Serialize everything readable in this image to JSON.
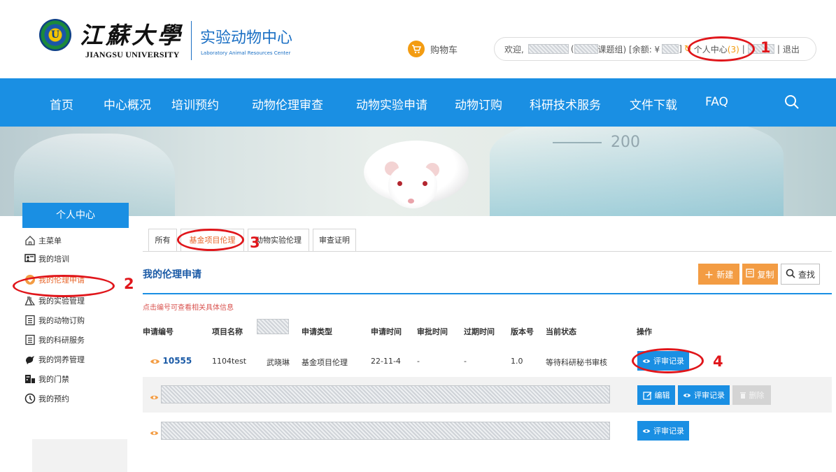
{
  "header": {
    "logo_cn": "江蘇大學",
    "logo_en": "JIANGSU UNIVERSITY",
    "logo_seal_letter": "U",
    "site_name_cn": "实验动物中心",
    "site_name_en": "Laboratory Animal Resources Center",
    "cart_label": "购物车",
    "user": {
      "welcome": "欢迎,",
      "group_suffix": "课题组) [余额: ¥",
      "balance_suffix": "]",
      "center_label": "个人中心",
      "center_count": "(3)",
      "separator": "|",
      "logout": "退出"
    }
  },
  "nav": {
    "items": [
      "首页",
      "中心概况",
      "培训预约",
      "动物伦理审查",
      "动物实验申请",
      "动物订购",
      "科研技术服务",
      "文件下载",
      "FAQ"
    ],
    "search_icon": "search-icon"
  },
  "banner": {
    "flask_number": "200"
  },
  "sidebar": {
    "title": "个人中心",
    "items": [
      {
        "label": "主菜单",
        "icon": "home-icon"
      },
      {
        "label": "我的培训",
        "icon": "training-icon"
      },
      {
        "label": "我的伦理申请",
        "icon": "heart-icon"
      },
      {
        "label": "我的实验管理",
        "icon": "flask-icon"
      },
      {
        "label": "我的动物订购",
        "icon": "document-icon"
      },
      {
        "label": "我的科研服务",
        "icon": "document-icon"
      },
      {
        "label": "我的饲养管理",
        "icon": "animal-icon"
      },
      {
        "label": "我的门禁",
        "icon": "access-icon"
      },
      {
        "label": "我的预约",
        "icon": "clock-icon"
      }
    ],
    "active_index": 2
  },
  "tabs": [
    {
      "label": "所有"
    },
    {
      "label": "基金项目伦理"
    },
    {
      "label": "动物实验伦理"
    },
    {
      "label": "审查证明"
    }
  ],
  "main": {
    "section_title": "我的伦理申请",
    "buttons": {
      "new": "新建",
      "copy": "复制",
      "find": "查找"
    },
    "hint": "点击编号可查看相关具体信息",
    "columns": [
      "申请编号",
      "项目名称",
      "",
      "申请类型",
      "申请时间",
      "审批时间",
      "过期时间",
      "版本号",
      "当前状态",
      "操作"
    ],
    "rows": [
      {
        "id": "10555",
        "project": "1104test",
        "applicant": "武晓琳",
        "type": "基金项目伦理",
        "apply_time": "22-11-4",
        "approve_time": "-",
        "expire_time": "-",
        "version": "1.0",
        "status": "等待科研秘书审核",
        "actions": [
          "评审记录"
        ]
      },
      {
        "id": "",
        "actions": [
          "编辑",
          "评审记录",
          "删除"
        ]
      },
      {
        "id": "",
        "actions": [
          "评审记录"
        ]
      }
    ]
  },
  "annotations": [
    "1",
    "2",
    "3",
    "4"
  ],
  "colors": {
    "primary_blue": "#1a8fe3",
    "accent_orange": "#f39c43",
    "annotation_red": "#e0161b",
    "link_blue": "#1a5aa6"
  }
}
